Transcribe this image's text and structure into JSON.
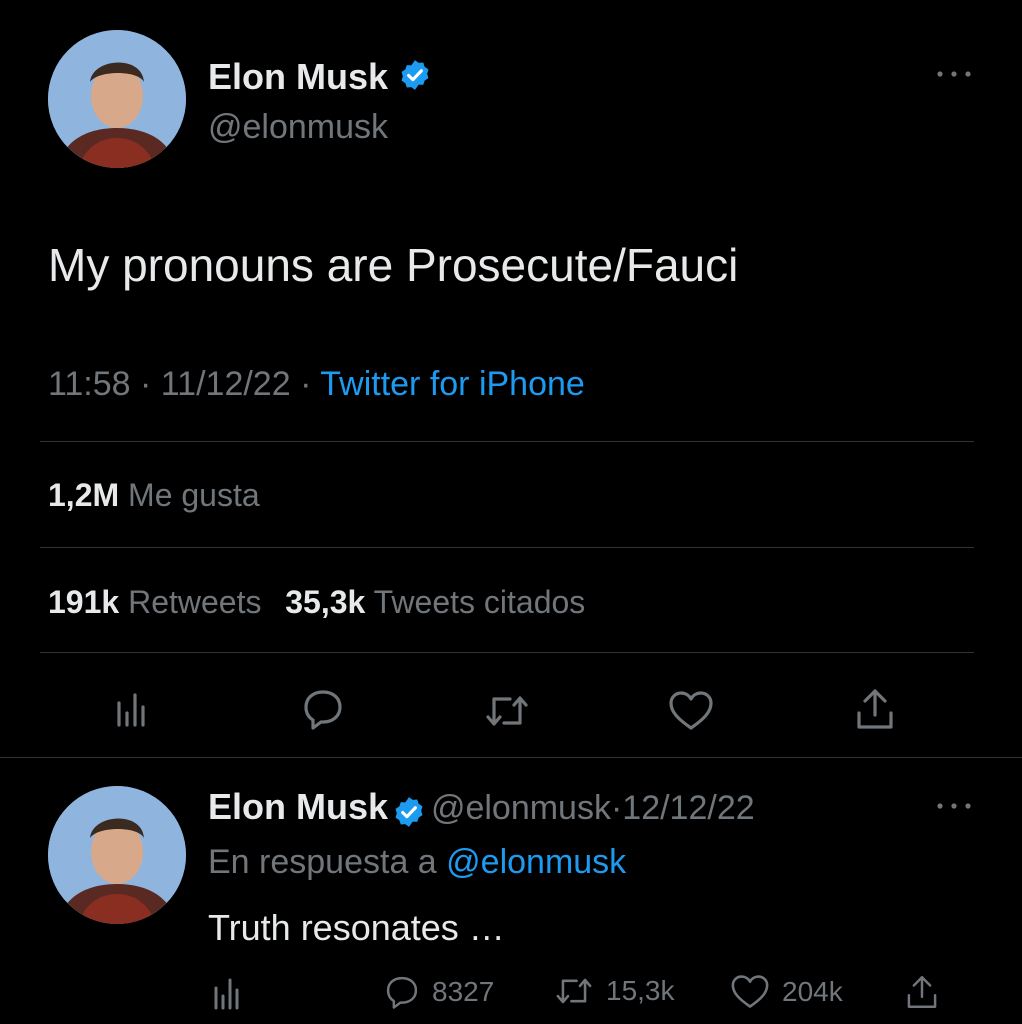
{
  "main_tweet": {
    "author": {
      "name": "Elon Musk",
      "handle": "@elonmusk",
      "verified": true
    },
    "more_icon": "more-dots-icon",
    "text": "My pronouns are Prosecute/Fauci",
    "time": "11:58",
    "date": "11/12/22",
    "separator": "·",
    "source": "Twitter for iPhone",
    "likes": {
      "count": "1,2M",
      "label": "Me gusta"
    },
    "retweets": {
      "count": "191k",
      "label": "Retweets"
    },
    "quotes": {
      "count": "35,3k",
      "label": "Tweets citados"
    },
    "actions": [
      "analytics-icon",
      "reply-icon",
      "retweet-icon",
      "like-icon",
      "share-icon"
    ]
  },
  "reply_tweet": {
    "author": {
      "name": "Elon Musk",
      "handle": "@elonmusk",
      "verified": true
    },
    "separator": "·",
    "date": "12/12/22",
    "replying_prefix": "En respuesta a",
    "replying_to": "@elonmusk",
    "text": "Truth resonates …",
    "stats": {
      "replies": "8327",
      "retweets": "15,3k",
      "likes": "204k"
    }
  },
  "colors": {
    "background": "#000000",
    "text": "#e7e9ea",
    "muted": "#71767b",
    "accent": "#1d9bf0",
    "divider": "#2f3336"
  }
}
